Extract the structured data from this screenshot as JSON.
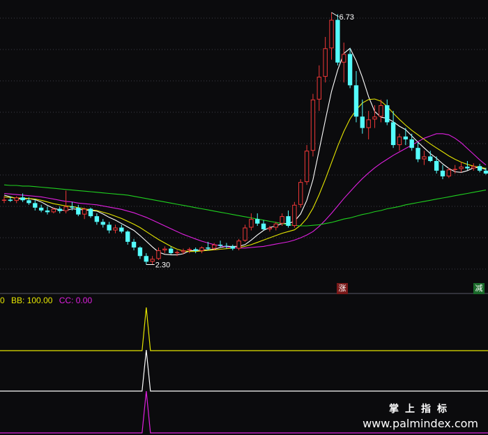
{
  "chart_data": [
    {
      "type": "candlestick",
      "title": "",
      "xlabel": "",
      "ylabel": "",
      "ylim": [
        2.0,
        6.9
      ],
      "grid": true,
      "annotations": {
        "high_label": "6.73",
        "low_label": "2.30",
        "up_tag": "涨",
        "down_tag": "减"
      },
      "candles": [
        [
          3.43,
          3.5,
          3.38,
          3.44
        ],
        [
          3.44,
          3.5,
          3.4,
          3.42
        ],
        [
          3.42,
          3.5,
          3.38,
          3.48
        ],
        [
          3.48,
          3.55,
          3.4,
          3.43
        ],
        [
          3.43,
          3.48,
          3.35,
          3.38
        ],
        [
          3.38,
          3.45,
          3.25,
          3.3
        ],
        [
          3.3,
          3.35,
          3.22,
          3.25
        ],
        [
          3.25,
          3.32,
          3.18,
          3.22
        ],
        [
          3.22,
          3.3,
          3.2,
          3.28
        ],
        [
          3.28,
          3.32,
          3.2,
          3.24
        ],
        [
          3.24,
          3.6,
          3.2,
          3.32
        ],
        [
          3.32,
          3.4,
          3.25,
          3.3
        ],
        [
          3.3,
          3.35,
          3.15,
          3.18
        ],
        [
          3.18,
          3.3,
          3.1,
          3.28
        ],
        [
          3.28,
          3.3,
          3.12,
          3.15
        ],
        [
          3.15,
          3.2,
          3.0,
          3.05
        ],
        [
          3.05,
          3.1,
          2.95,
          3.0
        ],
        [
          3.0,
          3.05,
          2.85,
          2.9
        ],
        [
          2.9,
          3.0,
          2.85,
          2.95
        ],
        [
          2.95,
          3.0,
          2.85,
          2.88
        ],
        [
          2.88,
          2.9,
          2.65,
          2.7
        ],
        [
          2.7,
          2.75,
          2.55,
          2.6
        ],
        [
          2.6,
          2.62,
          2.4,
          2.45
        ],
        [
          2.45,
          2.5,
          2.3,
          2.35
        ],
        [
          2.35,
          2.45,
          2.3,
          2.4
        ],
        [
          2.4,
          2.6,
          2.38,
          2.55
        ],
        [
          2.55,
          2.62,
          2.5,
          2.58
        ],
        [
          2.58,
          2.62,
          2.48,
          2.5
        ],
        [
          2.5,
          2.55,
          2.45,
          2.52
        ],
        [
          2.52,
          2.58,
          2.48,
          2.55
        ],
        [
          2.55,
          2.6,
          2.5,
          2.57
        ],
        [
          2.57,
          2.6,
          2.5,
          2.54
        ],
        [
          2.54,
          2.62,
          2.5,
          2.6
        ],
        [
          2.6,
          2.7,
          2.55,
          2.58
        ],
        [
          2.58,
          2.68,
          2.55,
          2.65
        ],
        [
          2.65,
          2.72,
          2.6,
          2.63
        ],
        [
          2.63,
          2.68,
          2.58,
          2.62
        ],
        [
          2.62,
          2.65,
          2.55,
          2.58
        ],
        [
          2.58,
          2.75,
          2.55,
          2.72
        ],
        [
          2.72,
          3.0,
          2.7,
          2.95
        ],
        [
          2.95,
          3.2,
          2.9,
          3.1
        ],
        [
          3.1,
          3.2,
          2.98,
          3.02
        ],
        [
          3.02,
          3.08,
          2.9,
          2.92
        ],
        [
          2.92,
          2.98,
          2.88,
          2.95
        ],
        [
          2.95,
          3.05,
          2.9,
          3.02
        ],
        [
          3.02,
          3.2,
          2.98,
          3.15
        ],
        [
          3.15,
          3.25,
          2.95,
          2.98
        ],
        [
          2.98,
          3.4,
          2.95,
          3.35
        ],
        [
          3.35,
          3.8,
          3.3,
          3.75
        ],
        [
          3.75,
          4.4,
          3.7,
          4.3
        ],
        [
          4.3,
          5.3,
          4.2,
          5.2
        ],
        [
          5.2,
          5.8,
          5.0,
          5.6
        ],
        [
          5.6,
          6.3,
          5.5,
          6.1
        ],
        [
          6.1,
          6.73,
          5.9,
          6.6
        ],
        [
          6.6,
          6.7,
          5.8,
          5.85
        ],
        [
          5.85,
          6.2,
          5.5,
          6.0
        ],
        [
          6.0,
          6.1,
          5.4,
          5.45
        ],
        [
          5.45,
          5.7,
          4.8,
          4.9
        ],
        [
          4.9,
          5.2,
          4.6,
          4.7
        ],
        [
          4.7,
          5.0,
          4.5,
          4.85
        ],
        [
          4.85,
          5.1,
          4.7,
          4.9
        ],
        [
          4.9,
          5.2,
          4.8,
          5.1
        ],
        [
          5.1,
          5.2,
          4.75,
          4.8
        ],
        [
          4.8,
          5.0,
          4.35,
          4.4
        ],
        [
          4.4,
          4.6,
          4.3,
          4.55
        ],
        [
          4.55,
          4.7,
          4.4,
          4.5
        ],
        [
          4.5,
          4.6,
          4.3,
          4.35
        ],
        [
          4.35,
          4.45,
          4.1,
          4.15
        ],
        [
          4.15,
          4.3,
          4.05,
          4.2
        ],
        [
          4.2,
          4.3,
          4.1,
          4.12
        ],
        [
          4.12,
          4.2,
          3.9,
          3.95
        ],
        [
          3.95,
          4.05,
          3.8,
          3.85
        ],
        [
          3.85,
          4.0,
          3.82,
          3.97
        ],
        [
          3.97,
          4.05,
          3.9,
          3.98
        ],
        [
          3.98,
          4.1,
          3.92,
          4.02
        ],
        [
          4.02,
          4.12,
          3.96,
          3.99
        ],
        [
          3.99,
          4.08,
          3.95,
          4.03
        ],
        [
          4.03,
          4.07,
          3.92,
          3.95
        ],
        [
          3.95,
          4.0,
          3.88,
          3.9
        ]
      ],
      "series": [
        {
          "color": "#ffffff",
          "values": [
            3.52,
            3.49,
            3.46,
            3.45,
            3.46,
            3.44,
            3.4,
            3.34,
            3.29,
            3.26,
            3.25,
            3.28,
            3.27,
            3.26,
            3.25,
            3.24,
            3.19,
            3.13,
            3.08,
            3.02,
            2.96,
            2.9,
            2.81,
            2.71,
            2.61,
            2.52,
            2.48,
            2.47,
            2.47,
            2.49,
            2.54,
            2.55,
            2.55,
            2.56,
            2.57,
            2.6,
            2.62,
            2.62,
            2.62,
            2.65,
            2.73,
            2.82,
            2.9,
            2.95,
            2.98,
            3.02,
            3.02,
            3.06,
            3.19,
            3.43,
            3.79,
            4.31,
            4.84,
            5.34,
            5.72,
            6.01,
            6.1,
            5.88,
            5.59,
            5.25,
            4.99,
            4.89,
            4.87,
            4.81,
            4.73,
            4.67,
            4.56,
            4.45,
            4.35,
            4.25,
            4.17,
            4.07,
            3.99,
            3.93,
            3.92,
            3.95,
            4.0,
            4.01,
            3.97
          ]
        },
        {
          "color": "#e6e600",
          "values": [
            3.49,
            3.48,
            3.47,
            3.47,
            3.46,
            3.45,
            3.43,
            3.4,
            3.37,
            3.35,
            3.33,
            3.32,
            3.3,
            3.28,
            3.26,
            3.25,
            3.22,
            3.19,
            3.15,
            3.11,
            3.06,
            3.01,
            2.95,
            2.88,
            2.81,
            2.74,
            2.68,
            2.62,
            2.57,
            2.54,
            2.53,
            2.53,
            2.54,
            2.55,
            2.56,
            2.57,
            2.58,
            2.59,
            2.6,
            2.62,
            2.65,
            2.69,
            2.73,
            2.77,
            2.81,
            2.85,
            2.88,
            2.91,
            2.99,
            3.11,
            3.29,
            3.53,
            3.8,
            4.09,
            4.38,
            4.64,
            4.86,
            5.02,
            5.14,
            5.2,
            5.21,
            5.17,
            5.08,
            4.96,
            4.85,
            4.75,
            4.66,
            4.58,
            4.5,
            4.42,
            4.35,
            4.28,
            4.21,
            4.15,
            4.1,
            4.06,
            4.03,
            4.01,
            3.99
          ]
        },
        {
          "color": "#e020e0",
          "values": [
            3.55,
            3.54,
            3.53,
            3.52,
            3.51,
            3.5,
            3.49,
            3.47,
            3.45,
            3.43,
            3.41,
            3.4,
            3.38,
            3.37,
            3.36,
            3.35,
            3.33,
            3.31,
            3.29,
            3.27,
            3.24,
            3.21,
            3.17,
            3.13,
            3.08,
            3.03,
            2.98,
            2.93,
            2.88,
            2.83,
            2.79,
            2.75,
            2.71,
            2.68,
            2.65,
            2.63,
            2.61,
            2.6,
            2.59,
            2.59,
            2.6,
            2.61,
            2.62,
            2.64,
            2.66,
            2.68,
            2.7,
            2.73,
            2.77,
            2.82,
            2.88,
            2.97,
            3.08,
            3.2,
            3.33,
            3.46,
            3.58,
            3.7,
            3.81,
            3.91,
            4.0,
            4.08,
            4.15,
            4.22,
            4.28,
            4.34,
            4.4,
            4.46,
            4.52,
            4.56,
            4.6,
            4.6,
            4.58,
            4.52,
            4.44,
            4.34,
            4.24,
            4.14,
            4.05
          ]
        },
        {
          "color": "#1fd01f",
          "values": [
            3.7,
            3.69,
            3.69,
            3.68,
            3.68,
            3.67,
            3.66,
            3.65,
            3.64,
            3.63,
            3.62,
            3.61,
            3.6,
            3.59,
            3.58,
            3.57,
            3.56,
            3.55,
            3.54,
            3.53,
            3.52,
            3.5,
            3.48,
            3.46,
            3.44,
            3.42,
            3.4,
            3.38,
            3.36,
            3.34,
            3.32,
            3.3,
            3.28,
            3.26,
            3.24,
            3.22,
            3.2,
            3.18,
            3.16,
            3.14,
            3.12,
            3.1,
            3.08,
            3.06,
            3.04,
            3.02,
            3.0,
            2.99,
            2.98,
            2.98,
            2.99,
            3.0,
            3.02,
            3.04,
            3.07,
            3.1,
            3.12,
            3.15,
            3.18,
            3.2,
            3.23,
            3.25,
            3.28,
            3.3,
            3.32,
            3.35,
            3.37,
            3.39,
            3.41,
            3.43,
            3.45,
            3.47,
            3.49,
            3.51,
            3.53,
            3.55,
            3.57,
            3.59,
            3.61
          ]
        }
      ]
    },
    {
      "type": "line",
      "title": "",
      "legend": [
        {
          "label": "0",
          "color": "#e6e600"
        },
        {
          "label": "BB: 100.00",
          "color": "#e6e600"
        },
        {
          "label": "CC: 0.00",
          "color": "#e020e0"
        }
      ],
      "spike_index": 23,
      "series": [
        {
          "color": "#e6e600",
          "baseline": 0,
          "peak": 100
        },
        {
          "color": "#ffffff",
          "baseline": 0,
          "peak": 100
        },
        {
          "color": "#e020e0",
          "baseline": 0,
          "peak": 100
        }
      ]
    }
  ],
  "colors": {
    "up": "#f03838",
    "down": "#54fcfc",
    "background": "#0b0b0d",
    "grid": "#3c3c46",
    "up_tag_bg": "#7a1a1a",
    "down_tag_bg": "#1a6a2a"
  },
  "watermark": {
    "cn": "掌上指标",
    "url": "www.palmindex.com"
  }
}
